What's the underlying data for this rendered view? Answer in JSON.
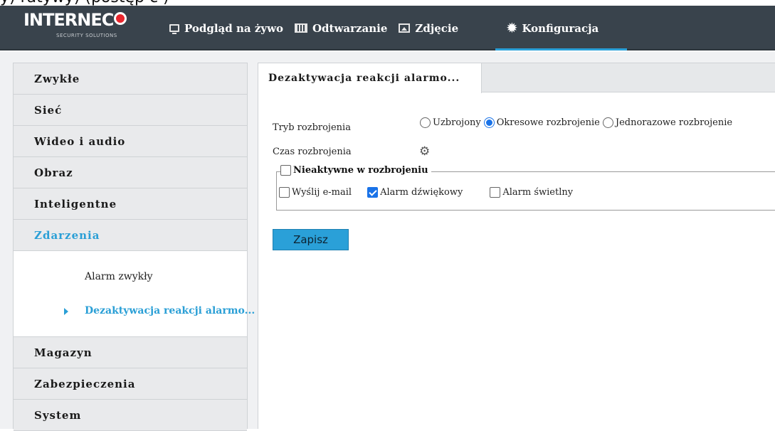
{
  "top_strip": {
    "text": "y) ratywy) (postęp c ) "
  },
  "logo": {
    "brand": "INTERNEC",
    "tagline": "SECURITY SOLUTIONS"
  },
  "nav": {
    "items": [
      {
        "label": "Podgląd na żywo",
        "icon": "monitor-icon"
      },
      {
        "label": "Odtwarzanie",
        "icon": "film-icon"
      },
      {
        "label": "Zdjęcie",
        "icon": "image-icon"
      },
      {
        "label": "Konfiguracja",
        "icon": "gear-icon",
        "active": true
      }
    ]
  },
  "sidebar": {
    "items": [
      {
        "label": "Zwykłe"
      },
      {
        "label": "Sieć"
      },
      {
        "label": "Wideo i audio"
      },
      {
        "label": "Obraz"
      },
      {
        "label": "Inteligentne"
      },
      {
        "label": "Zdarzenia",
        "active": true
      },
      {
        "label": "Magazyn"
      },
      {
        "label": "Zabezpieczenia"
      },
      {
        "label": "System"
      }
    ],
    "submenu": [
      {
        "label": "Alarm zwykły"
      },
      {
        "label": "Dezaktywacja reakcji alarmo...",
        "active": true
      }
    ]
  },
  "main": {
    "tab_label": "Dezaktywacja reakcji alarmo...",
    "mode_label": "Tryb rozbrojenia",
    "mode_options": [
      {
        "label": "Uzbrojony",
        "checked": false
      },
      {
        "label": "Okresowe rozbrojenie",
        "checked": true
      },
      {
        "label": "Jednorazowe rozbrojenie",
        "checked": false
      }
    ],
    "time_label": "Czas rozbrojenia",
    "group": {
      "legend": "Nieaktywne w rozbrojeniu",
      "legend_checked": false,
      "options": [
        {
          "label": "Wyślij e-mail",
          "checked": false
        },
        {
          "label": "Alarm dźwiękowy",
          "checked": true
        },
        {
          "label": "Alarm świetlny",
          "checked": false
        }
      ]
    },
    "save_label": "Zapisz"
  },
  "colors": {
    "navbar": "#39434c",
    "accent": "#2aa0d8",
    "radio_checked": "#1a73e8",
    "brand_red": "#e8262d"
  }
}
